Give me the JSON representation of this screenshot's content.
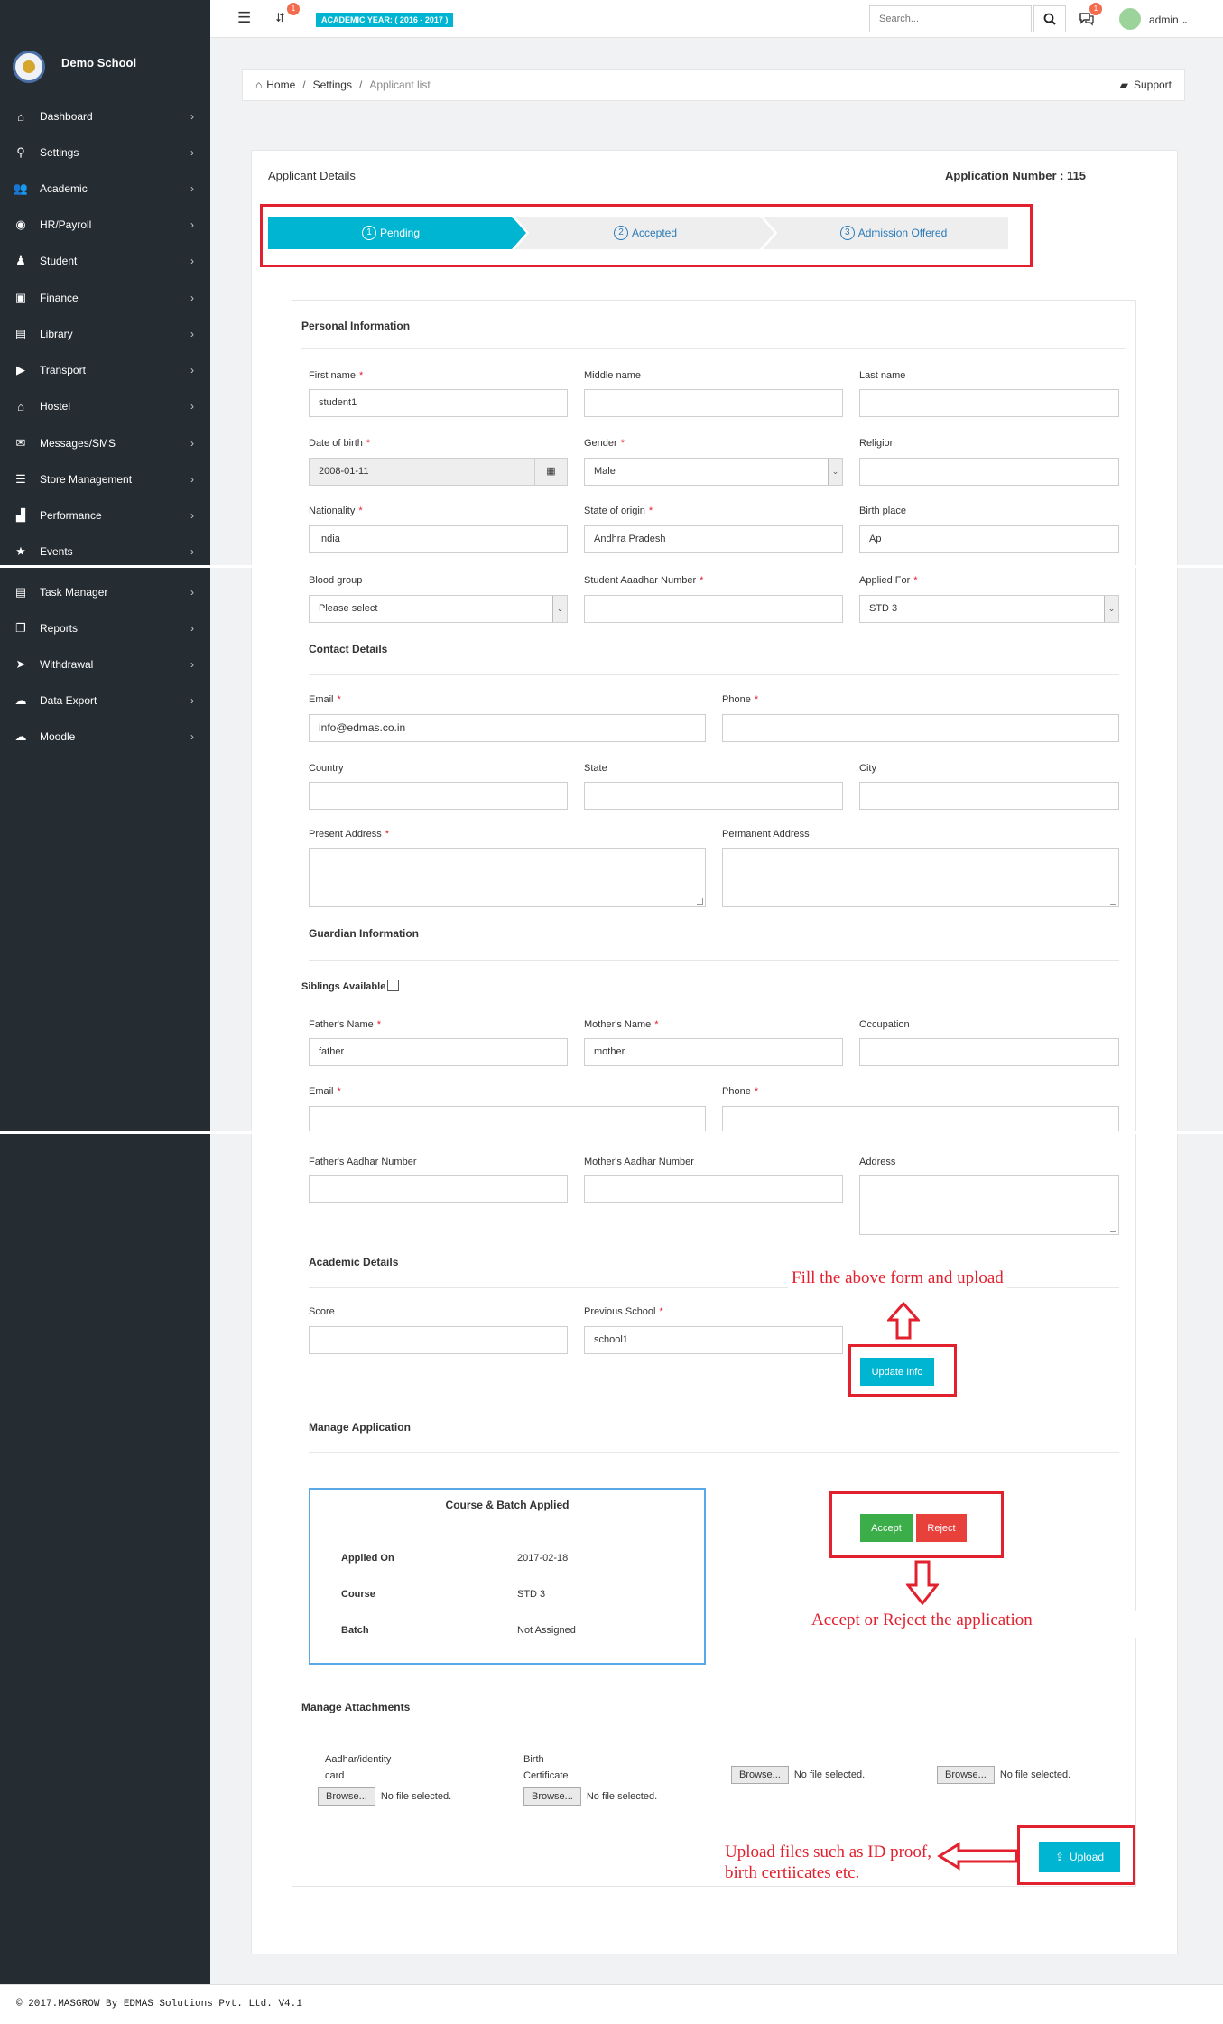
{
  "school_name": "Demo School",
  "sidebar": [
    {
      "label": "Dashboard",
      "icon": "home-icon"
    },
    {
      "label": "Settings",
      "icon": "wrench-icon"
    },
    {
      "label": "Academic",
      "icon": "users-icon"
    },
    {
      "label": "HR/Payroll",
      "icon": "eye-icon"
    },
    {
      "label": "Student",
      "icon": "user-icon"
    },
    {
      "label": "Finance",
      "icon": "money-icon"
    },
    {
      "label": "Library",
      "icon": "book-icon"
    },
    {
      "label": "Transport",
      "icon": "truck-icon"
    },
    {
      "label": "Hostel",
      "icon": "house-icon"
    },
    {
      "label": "Messages/SMS",
      "icon": "envelope-icon"
    },
    {
      "label": "Store Management",
      "icon": "list-icon"
    },
    {
      "label": "Performance",
      "icon": "chart-icon"
    },
    {
      "label": "Events",
      "icon": "star-icon"
    },
    {
      "label": "Task Manager",
      "icon": "tasks-icon"
    },
    {
      "label": "Reports",
      "icon": "copy-icon"
    },
    {
      "label": "Withdrawal",
      "icon": "paper-plane-icon"
    },
    {
      "label": "Data Export",
      "icon": "cloud-download-icon"
    },
    {
      "label": "Moodle",
      "icon": "cloud-icon"
    }
  ],
  "topbar": {
    "badge_count": "1",
    "academic_year": "ACADEMIC YEAR: ( 2016 - 2017 )",
    "search_placeholder": "Search...",
    "chat_badge": "1",
    "user": "admin"
  },
  "breadcrumb": {
    "home": "Home",
    "settings": "Settings",
    "current": "Applicant list",
    "support": "Support"
  },
  "panel": {
    "title": "Applicant Details",
    "app_number": "Application Number : 115"
  },
  "wizard": [
    {
      "n": "1",
      "label": "Pending"
    },
    {
      "n": "2",
      "label": "Accepted"
    },
    {
      "n": "3",
      "label": "Admission Offered"
    }
  ],
  "personal": {
    "heading": "Personal Information",
    "first_name_label": "First name",
    "first_name": "student1",
    "middle_name_label": "Middle name",
    "last_name_label": "Last name",
    "dob_label": "Date of birth",
    "dob": "2008-01-11",
    "gender_label": "Gender",
    "gender": "Male",
    "religion_label": "Religion",
    "nationality_label": "Nationality",
    "nationality": "India",
    "state_origin_label": "State of origin",
    "state_origin": "Andhra Pradesh",
    "birth_place_label": "Birth place",
    "birth_place": "Ap",
    "blood_group_label": "Blood group",
    "blood_group": "Please select",
    "aadhar_label": "Student Aaadhar Number",
    "applied_for_label": "Applied For",
    "applied_for": "STD 3"
  },
  "contact": {
    "heading": "Contact Details",
    "email_label": "Email",
    "email": "info@edmas.co.in",
    "phone_label": "Phone",
    "country_label": "Country",
    "state_label": "State",
    "city_label": "City",
    "present_address_label": "Present Address",
    "permanent_address_label": "Permanent Address"
  },
  "guardian": {
    "heading": "Guardian Information",
    "siblings_label": "Siblings Available",
    "father_label": "Father's Name",
    "father": "father",
    "mother_label": "Mother's Name",
    "mother": "mother",
    "occupation_label": "Occupation",
    "email_label": "Email",
    "phone_label": "Phone",
    "father_aadhar_label": "Father's Aadhar Number",
    "mother_aadhar_label": "Mother's Aadhar Number",
    "address_label": "Address"
  },
  "academic": {
    "heading": "Academic Details",
    "score_label": "Score",
    "prev_school_label": "Previous School",
    "prev_school": "school1",
    "update_button": "Update Info"
  },
  "manage": {
    "heading": "Manage Application",
    "box_title": "Course & Batch Applied",
    "applied_on_label": "Applied On",
    "applied_on": "2017-02-18",
    "course_label": "Course",
    "course": "STD 3",
    "batch_label": "Batch",
    "batch": "Not Assigned",
    "accept": "Accept",
    "reject": "Reject"
  },
  "attachments": {
    "heading": "Manage Attachments",
    "aadhar_label": "Aadhar/identity card",
    "birth_label": "Birth Certificate",
    "browse": "Browse...",
    "no_file": "No file selected.",
    "upload": "Upload"
  },
  "annotations": {
    "fill_form": "Fill the above form and upload",
    "accept_reject": "Accept or Reject the application",
    "upload_files": "Upload files such as ID proof, birth certiicates etc."
  },
  "colors": {
    "sidebar": "#252d33",
    "accent": "#00b5d1",
    "accept": "#3cae49",
    "reject": "#e8403b",
    "annotation": "#e2202e"
  },
  "footer": "© 2017.MASGROW By EDMAS Solutions Pvt. Ltd. V4.1"
}
